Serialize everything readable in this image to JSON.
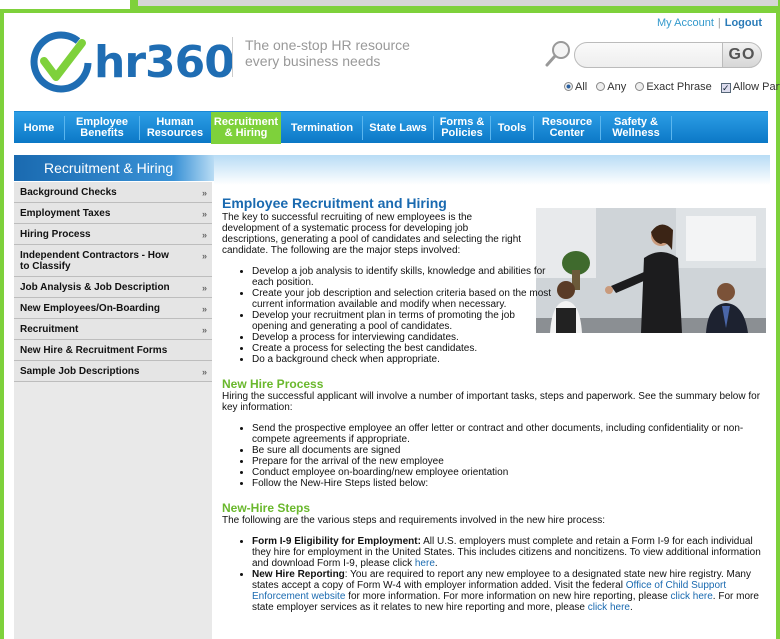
{
  "header": {
    "my_account": "My Account",
    "logout": "Logout",
    "logo_text": "hr360",
    "tagline": "The one-stop HR resource every business needs"
  },
  "search": {
    "placeholder": "",
    "go_label": "GO",
    "options": {
      "all": "All",
      "any": "Any",
      "exact": "Exact Phrase",
      "partial": "Allow Partial"
    },
    "selected": "all",
    "allow_partial_checked": true
  },
  "nav": {
    "items": [
      {
        "line1": "Home",
        "line2": ""
      },
      {
        "line1": "Employee",
        "line2": "Benefits"
      },
      {
        "line1": "Human",
        "line2": "Resources"
      },
      {
        "line1": "Recruitment",
        "line2": "& Hiring"
      },
      {
        "line1": "Termination",
        "line2": ""
      },
      {
        "line1": "State Laws",
        "line2": ""
      },
      {
        "line1": "Forms &",
        "line2": "Policies"
      },
      {
        "line1": "Tools",
        "line2": ""
      },
      {
        "line1": "Resource",
        "line2": "Center"
      },
      {
        "line1": "Safety &",
        "line2": "Wellness"
      }
    ],
    "active": "Recruitment & Hiring"
  },
  "sidebar": {
    "title": "Recruitment & Hiring",
    "items": [
      {
        "label": "Background Checks",
        "chevron": "»"
      },
      {
        "label": "Employment Taxes",
        "chevron": "»"
      },
      {
        "label": "Hiring Process",
        "chevron": "»"
      },
      {
        "label": "Independent Contractors - How to Classify",
        "chevron": "»"
      },
      {
        "label": "Job Analysis & Job Description",
        "chevron": "»"
      },
      {
        "label": "New Employees/On-Boarding",
        "chevron": "»"
      },
      {
        "label": "Recruitment",
        "chevron": "»"
      },
      {
        "label": "New Hire & Recruitment Forms",
        "chevron": ""
      },
      {
        "label": "Sample Job Descriptions",
        "chevron": "»"
      }
    ]
  },
  "main": {
    "title": "Employee Recruitment and Hiring",
    "intro": "The key to successful recruiting of new employees is the development of a systematic process for developing job descriptions, generating a pool of candidates and selecting the right candidate. The following are the major steps involved:",
    "steps": [
      "Develop a job analysis to identify skills, knowledge and abilities for each position.",
      "Create your job description and selection criteria based on the most current information available and modify when necessary.",
      "Develop your recruitment plan in terms of promoting the job opening and generating a pool of candidates.",
      "Develop a process for interviewing candidates.",
      "Create a process for selecting the best candidates.",
      "Do a background check when appropriate."
    ],
    "new_hire_title": "New Hire Process",
    "new_hire_intro": "Hiring the successful applicant will involve a number of important tasks, steps and paperwork. See the summary below for key information:",
    "new_hire_items": [
      "Send the prospective employee an offer letter or contract and other documents, including confidentiality or non-compete agreements if appropriate.",
      "Be sure all documents are signed",
      "Prepare for the arrival of the new employee",
      "Conduct employee on-boarding/new employee orientation",
      "Follow the New-Hire Steps listed below:"
    ],
    "steps_title": "New-Hire Steps",
    "steps_intro": "The following are the various steps and requirements involved in the new hire process:",
    "i9_title": "Form I-9 Eligibility for Employment:",
    "i9_text": " All U.S. employers must complete and retain a Form I-9 for each individual they hire for employment in the United States. This includes citizens and noncitizens. To view    additional information and download Form I-9, please click ",
    "here": "here",
    "period": ".",
    "reporting_title": "New Hire Reporting",
    "reporting_text1": ": You are required to report any new employee to a designated state new hire registry. Many states accept a copy of Form W-4 with employer information added. Visit the federal ",
    "ocse_link": "Office of Child Support Enforcement website",
    "reporting_text2": " for more information. For more information on new hire reporting, please ",
    "click_here": "click here",
    "reporting_text3": ". For more state employer services as it relates to new hire reporting and more, please ",
    "reporting_text4": "."
  }
}
